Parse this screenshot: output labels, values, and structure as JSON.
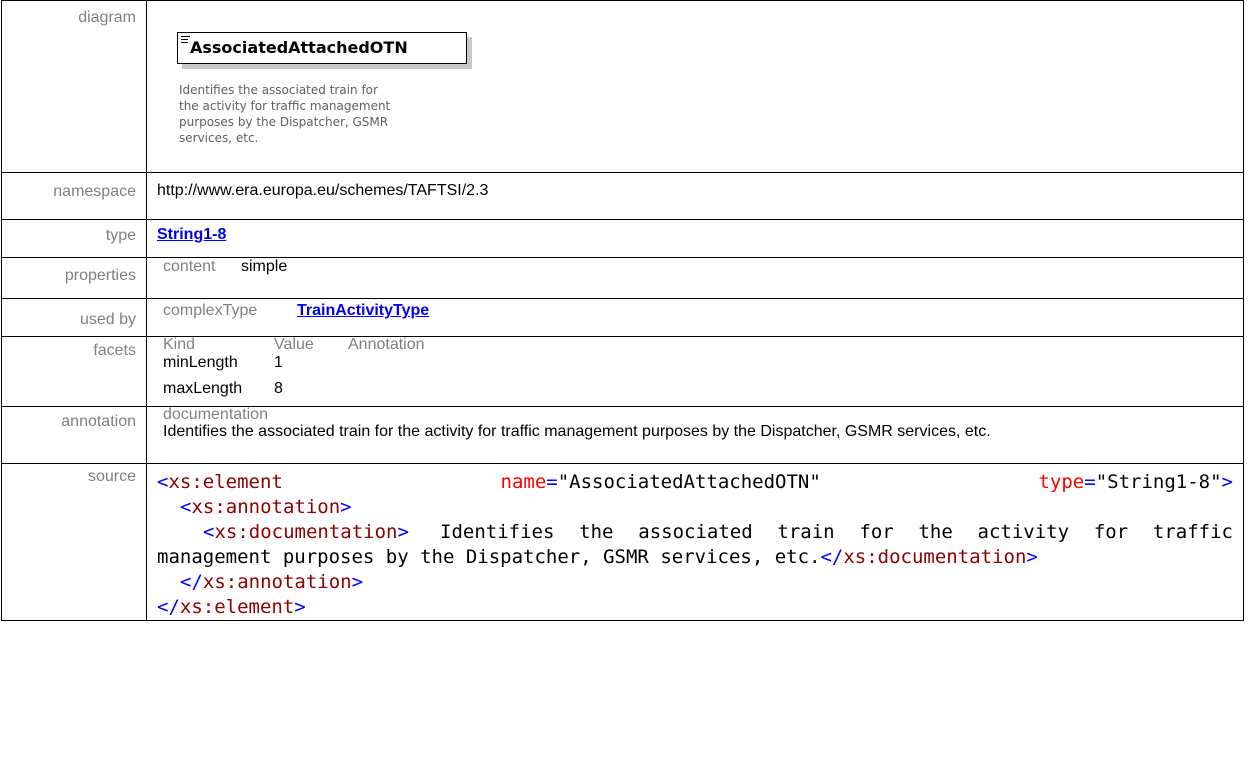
{
  "labels": {
    "diagram": "diagram",
    "namespace": "namespace",
    "type": "type",
    "properties": "properties",
    "used_by": "used by",
    "facets": "facets",
    "annotation": "annotation",
    "source": "source"
  },
  "diagram": {
    "title": "AssociatedAttachedOTN",
    "description": "Identifies the associated train for the activity for traffic management purposes by the Dispatcher, GSMR services, etc."
  },
  "namespace": "http://www.era.europa.eu/schemes/TAFTSI/2.3",
  "type": "String1-8",
  "properties": {
    "key": "content",
    "value": "simple"
  },
  "used_by": {
    "kind": "complexType",
    "name": "TrainActivityType"
  },
  "facets": {
    "headers": [
      "Kind",
      "Value",
      "Annotation"
    ],
    "rows": [
      {
        "kind": "minLength",
        "value": "1"
      },
      {
        "kind": "maxLength",
        "value": "8"
      }
    ]
  },
  "annotation": {
    "label": "documentation",
    "text": "Identifies the associated train for the activity for traffic management purposes by the Dispatcher, GSMR services, etc."
  },
  "source": {
    "open_tag": "xs:element",
    "attr1_name": "name",
    "attr1_value": "\"AssociatedAttachedOTN\"",
    "attr2_name": "type",
    "attr2_value": "\"String1-8\"",
    "annotation_tag": "xs:annotation",
    "doc_tag": "xs:documentation",
    "doc_text": "Identifies the associated train for the activity for traffic management purposes by the Dispatcher, GSMR services, etc.",
    "close_annotation": "xs:annotation",
    "close_element": "xs:element"
  }
}
